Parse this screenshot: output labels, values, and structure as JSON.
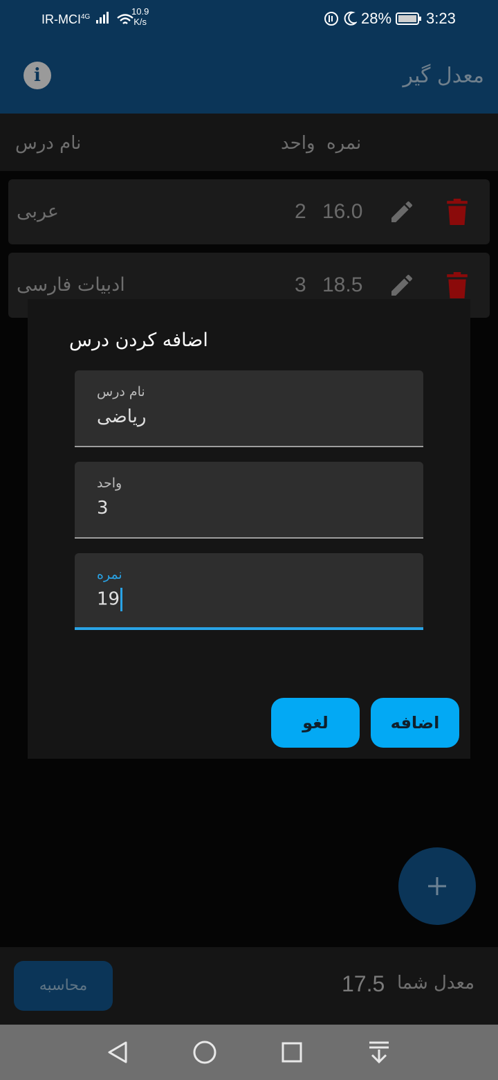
{
  "status_bar": {
    "carrier": "IR-MCI",
    "network_type": "4G",
    "net_speed": "10.9",
    "net_speed_unit": "K/s",
    "battery": "28%",
    "time": "3:23"
  },
  "app_bar": {
    "title": "معدل گیر"
  },
  "table_header": {
    "name_col": "نام درس",
    "grade_col": "نمره",
    "unit_col": "واحد"
  },
  "courses": [
    {
      "name": "عربی",
      "grade": "16.0",
      "units": "2"
    },
    {
      "name": "ادبیات فارسی",
      "grade": "18.5",
      "units": "3"
    }
  ],
  "dialog": {
    "title": "اضافه کردن درس",
    "fields": [
      {
        "label": "نام درس",
        "value": "ریاضی"
      },
      {
        "label": "واحد",
        "value": "3"
      },
      {
        "label": "نمره",
        "value": "19"
      }
    ],
    "add_label": "اضافه",
    "cancel_label": "لغو"
  },
  "footer": {
    "calc_label": "محاسبه",
    "avg_label": "معدل شما",
    "avg_value": "17.5"
  },
  "colors": {
    "accent": "#03a9f4",
    "primary": "#0b3558",
    "danger": "#8b0a0a"
  },
  "icons": [
    "info-icon",
    "edit-icon",
    "trash-icon",
    "plus-icon",
    "back-icon",
    "home-icon",
    "recents-icon",
    "notification-pull-icon"
  ]
}
